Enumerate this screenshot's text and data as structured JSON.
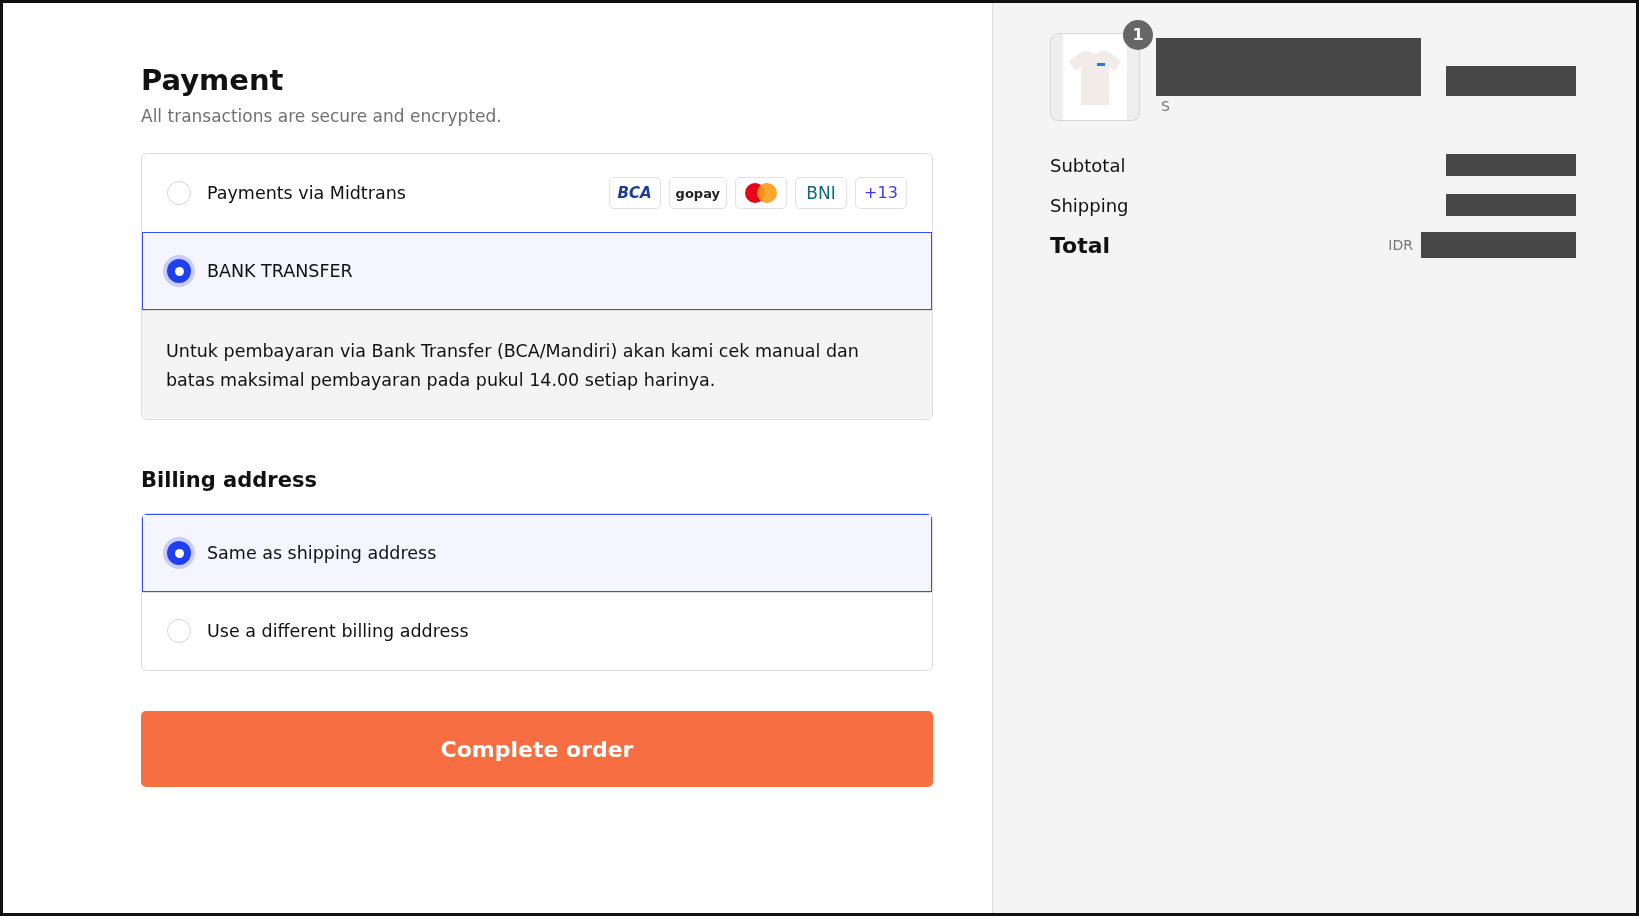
{
  "payment": {
    "title": "Payment",
    "subtitle": "All transactions are secure and encrypted.",
    "methods": [
      {
        "label": "Payments via Midtrans",
        "selected": false,
        "logos": [
          {
            "kind": "bca",
            "text": "BCA"
          },
          {
            "kind": "gopay",
            "text": "gopay"
          },
          {
            "kind": "mastercard"
          },
          {
            "kind": "bni",
            "text": "BNI"
          },
          {
            "kind": "more",
            "text": "+13"
          }
        ]
      },
      {
        "label": "BANK TRANSFER",
        "selected": true,
        "details": "Untuk pembayaran via Bank Transfer (BCA/Mandiri) akan kami cek manual dan batas maksimal pembayaran pada pukul 14.00 setiap harinya."
      }
    ]
  },
  "billing": {
    "title": "Billing address",
    "options": [
      {
        "label": "Same as shipping address",
        "selected": true
      },
      {
        "label": "Use a different billing address",
        "selected": false
      }
    ]
  },
  "submit": {
    "label": "Complete order"
  },
  "summary": {
    "item": {
      "quantity": "1",
      "variant": "S"
    },
    "lines": [
      {
        "label": "Subtotal",
        "kind": "normal"
      },
      {
        "label": "Shipping",
        "kind": "normal"
      },
      {
        "label": "Total",
        "kind": "total",
        "currency": "IDR"
      }
    ]
  }
}
